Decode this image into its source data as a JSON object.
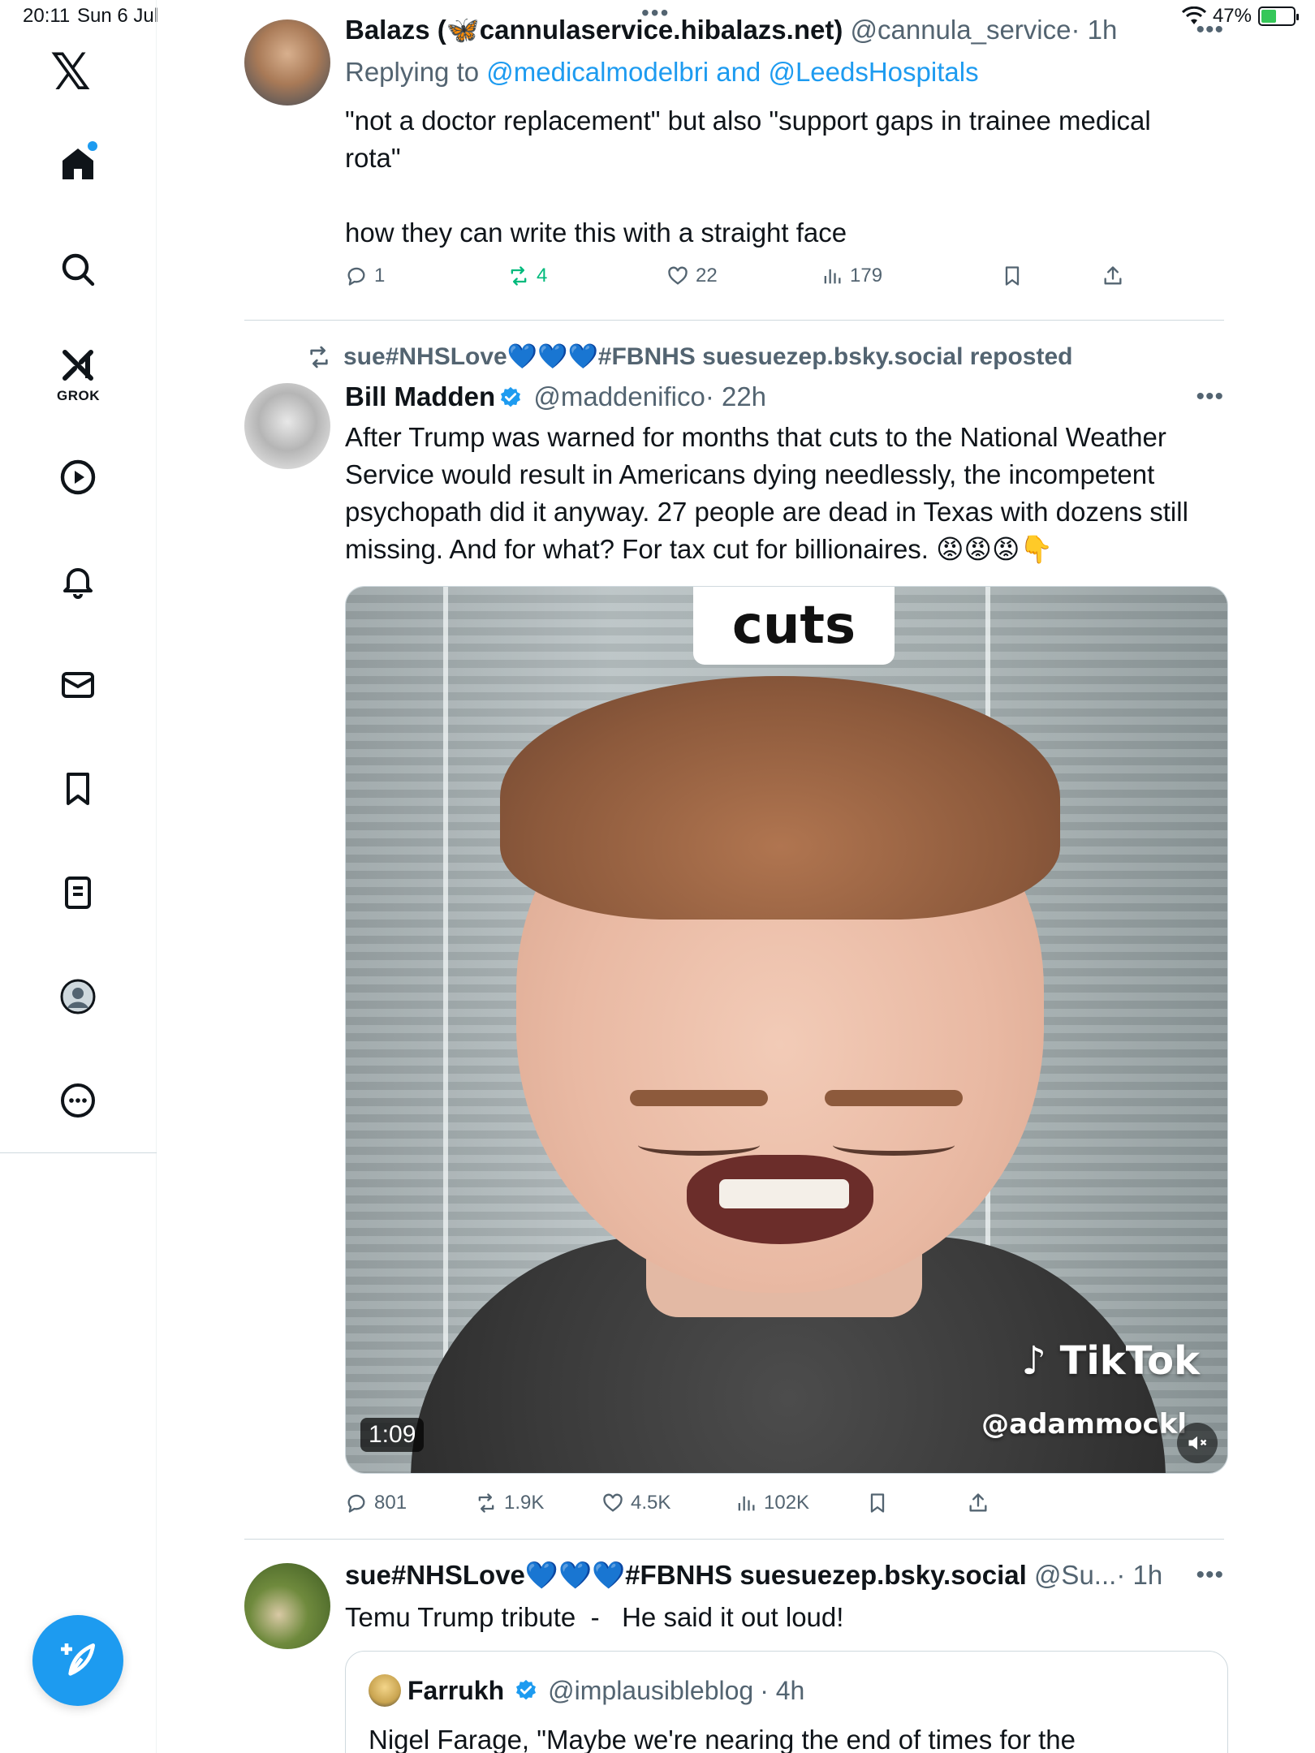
{
  "status_bar": {
    "time": "20:11",
    "date": "Sun 6 Jul",
    "battery": "47%",
    "battery_level": 0.47,
    "center_dots": "•••"
  },
  "sidebar": {
    "logo": "𝕏",
    "grok_label": "GROK",
    "items": [
      {
        "name": "home",
        "icon": "home-icon"
      },
      {
        "name": "search",
        "icon": "search-icon"
      },
      {
        "name": "grok",
        "icon": "grok-icon"
      },
      {
        "name": "videos",
        "icon": "play-icon"
      },
      {
        "name": "notifications",
        "icon": "bell-icon"
      },
      {
        "name": "messages",
        "icon": "mail-icon"
      },
      {
        "name": "bookmarks",
        "icon": "bookmark-icon"
      },
      {
        "name": "lists",
        "icon": "list-icon"
      },
      {
        "name": "profile",
        "icon": "profile-icon"
      },
      {
        "name": "more",
        "icon": "more-icon"
      }
    ],
    "compose_icon": "compose-icon"
  },
  "tweets": [
    {
      "name": "Balazs (🦋cannulaservice.hibalazs.net)",
      "handle": "@cannula_service",
      "time": "· 1h",
      "replying_prefix": "Replying to",
      "replying_to": "@medicalmodelbri and @LeedsHospitals",
      "text_lines": [
        "\"not a doctor replacement\" but also \"support gaps in trainee medical",
        "rota\"",
        "how they can write this with a straight face"
      ],
      "stats": {
        "replies": "1",
        "reposts": "4",
        "likes": "22",
        "views": "179"
      }
    },
    {
      "reposted_by": "sue#NHSLove💙💙💙#FBNHS suesuezep.bsky.social reposted",
      "name": "Bill Madden",
      "handle": "@maddenifico",
      "time": "· 22h",
      "text_lines": [
        "After Trump was warned for months that cuts to the National Weather",
        "Service would result in Americans dying needlessly, the incompetent",
        "psychopath did it anyway. 27 people are dead in Texas with dozens still",
        "missing. And for what? For tax cut for billionaires. 😡😡😡👇"
      ],
      "media": {
        "caption": "cuts",
        "watermark": "♪ TikTok",
        "watermark_handle": "@adammockl",
        "duration": "1:09"
      },
      "stats": {
        "replies": "801",
        "reposts": "1.9K",
        "likes": "4.5K",
        "views": "102K"
      }
    },
    {
      "name": "sue#NHSLove💙💙💙#FBNHS suesuezep.bsky.social",
      "handle": "@Su...",
      "time": "· 1h",
      "text": "Temu Trump tribute  -   He said it out loud!",
      "quote": {
        "name": "Farrukh",
        "handle": "@implausibleblog",
        "time": "· 4h",
        "text": "Nigel Farage, \"Maybe we're nearing the end of times for the"
      }
    }
  ],
  "colors": {
    "accent": "#1d9bf0",
    "text": "#0f1419",
    "secondary": "#536471",
    "repost_green": "#00ba7c",
    "divider": "#cfd9de"
  }
}
